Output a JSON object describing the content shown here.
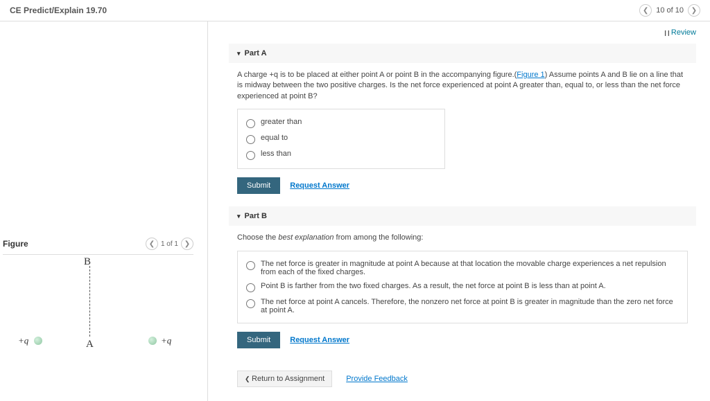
{
  "header": {
    "title": "CE Predict/Explain 19.70",
    "position": "10 of 10"
  },
  "review_label": "Review",
  "partA": {
    "title": "Part A",
    "question_pre": "A charge +q is to be placed at either point A or point B in the accompanying figure.(",
    "figure_link": "Figure 1",
    "question_post": ") Assume points A and B lie on a line that is midway between the two positive charges. Is the net force experienced at point A greater than, equal to, or less than the net force experienced at point B?",
    "options": [
      "greater than",
      "equal to",
      "less than"
    ],
    "submit": "Submit",
    "request": "Request Answer"
  },
  "partB": {
    "title": "Part B",
    "prompt": "Choose the best explanation from among the following:",
    "options": [
      "The net force is greater in magnitude at point A because at that location the movable charge experiences a net repulsion from each of the fixed charges.",
      "Point B is farther from the two fixed charges. As a result, the net force at point B is less than at point A.",
      "The net force at point A cancels. Therefore, the nonzero net force at point B is greater in magnitude than the zero net force at point A."
    ],
    "submit": "Submit",
    "request": "Request Answer"
  },
  "footer": {
    "return": "Return to Assignment",
    "feedback": "Provide Feedback"
  },
  "figure": {
    "title": "Figure",
    "position": "1 of 1",
    "labels": {
      "B": "B",
      "A": "A",
      "q1": "+q",
      "q2": "+q"
    }
  }
}
